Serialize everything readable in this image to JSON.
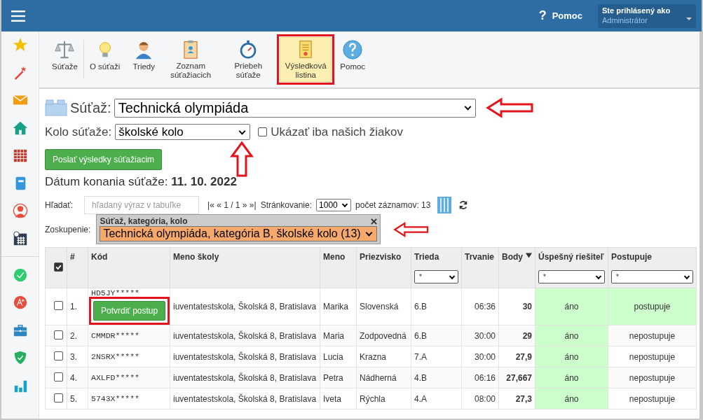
{
  "header": {
    "help": {
      "icon": "?",
      "label": "Pomoc"
    },
    "user": {
      "caption": "Ste prihlásený ako",
      "name": "Administrátor"
    }
  },
  "sidebar": {
    "items": [
      {
        "kind": "star"
      },
      {
        "kind": "wand"
      },
      {
        "kind": "mail"
      },
      {
        "kind": "home"
      },
      {
        "kind": "grid"
      },
      {
        "kind": "notebook"
      },
      {
        "kind": "person"
      },
      {
        "kind": "calendar"
      },
      {
        "kind": "check"
      },
      {
        "kind": "grade"
      },
      {
        "kind": "briefcase"
      },
      {
        "kind": "shield"
      },
      {
        "kind": "chart"
      }
    ]
  },
  "toolbar": {
    "items": [
      {
        "kind": "scales",
        "label": "Súťaže",
        "selected": false,
        "annotated": false
      },
      {
        "kind": "bulb",
        "label": "O súťaži",
        "selected": false,
        "annotated": false
      },
      {
        "kind": "person",
        "label": "Triedy",
        "selected": false,
        "annotated": false
      },
      {
        "kind": "clipboard",
        "label": "Zoznam súťažiacich",
        "selected": false,
        "annotated": false
      },
      {
        "kind": "stopwatch",
        "label": "Priebeh súťaže",
        "selected": false,
        "annotated": false
      },
      {
        "kind": "certificate",
        "label": "Výsledková listina",
        "selected": true,
        "annotated": true
      },
      {
        "kind": "help",
        "label": "Pomoc",
        "selected": false,
        "annotated": false
      }
    ]
  },
  "competition": {
    "label": "Súťaž:",
    "value": "Technická olympiáda",
    "arrow": true
  },
  "round": {
    "label": "Kolo súťaže:",
    "value": "školské kolo",
    "arrow": true,
    "only_ours": {
      "label": "Ukázať iba našich žiakov",
      "checked": false
    }
  },
  "send_button": "Poslať výsledky súťažiacim",
  "date": {
    "label": "Dátum konania súťaže:",
    "value": "11. 10. 2022"
  },
  "search": {
    "label": "Hľadať:",
    "placeholder": "hľadaný výraz v tabuľke"
  },
  "pager": {
    "nav": "|« « 1 / 1 » »|",
    "paging_label": "Stránkovanie:",
    "paging_value": "1000",
    "count": "počet záznamov: 13"
  },
  "grouping": {
    "label": "Zoskupenie:",
    "caption": "Súťaž, kategória, kolo",
    "value": "Technická olympiáda, kategória B, školské kolo (13)",
    "arrow": true
  },
  "table": {
    "all_checked": true,
    "columns": [
      {
        "label": "#"
      },
      {
        "label": "Kód"
      },
      {
        "label": "Meno školy"
      },
      {
        "label": "Meno"
      },
      {
        "label": "Priezvisko"
      },
      {
        "label": "Trieda",
        "filter": "*"
      },
      {
        "label": "Trvanie"
      },
      {
        "label": "Body",
        "sorted": true
      },
      {
        "label": "Úspešný riešiteľ",
        "filter": "*"
      },
      {
        "label": "Postupuje",
        "filter": "*"
      }
    ],
    "rows": [
      {
        "selected": false,
        "number": "1.",
        "code": "HD5JY*****",
        "button": "Potvrdiť postup",
        "annotated": true,
        "school": "iuventatestskola, Školská 8, Bratislava",
        "name": "Marika",
        "surname": "Slovenská",
        "class": "6.B",
        "time": "06:36",
        "points": "30",
        "successful": "áno",
        "advances": "postupuje",
        "advancing": true
      },
      {
        "selected": false,
        "number": "2.",
        "code": "CMMDR*****",
        "school": "iuventatestskola, Školská 8, Bratislava",
        "name": "Maria",
        "surname": "Zodpovedná",
        "class": "6.B",
        "time": "30:00",
        "points": "29",
        "successful": "áno",
        "advances": "nepostupuje",
        "advancing": false
      },
      {
        "selected": false,
        "number": "3.",
        "code": "2NSRX*****",
        "school": "iuventatestskola, Školská 8, Bratislava",
        "name": "Lucia",
        "surname": "Krazna",
        "class": "7.A",
        "time": "30:00",
        "points": "27,9",
        "successful": "áno",
        "advances": "nepostupuje",
        "advancing": false
      },
      {
        "selected": false,
        "number": "4.",
        "code": "AXLFD*****",
        "school": "iuventatestskola, Školská 8, Bratislava",
        "name": "Petra",
        "surname": "Nádherná",
        "class": "4.B",
        "time": "06:16",
        "points": "27,667",
        "successful": "áno",
        "advances": "nepostupuje",
        "advancing": false
      },
      {
        "selected": false,
        "number": "5.",
        "code": "5743X*****",
        "school": "iuventatestskola, Školská 8, Bratislava",
        "name": "Iveta",
        "surname": "Rýchla",
        "class": "4.A",
        "time": "08:00",
        "points": "27,3",
        "successful": "áno",
        "advances": "nepostupuje",
        "advancing": false
      }
    ]
  }
}
